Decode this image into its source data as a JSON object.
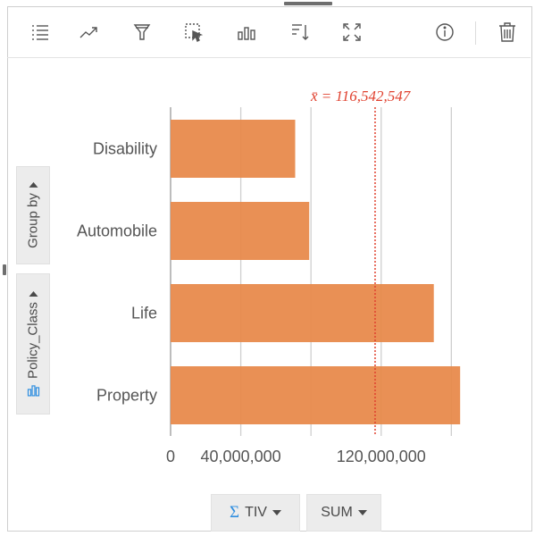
{
  "toolbar": {
    "icons": [
      "legend-icon",
      "trend-line-icon",
      "filter-icon",
      "select-icon",
      "visualization-type-icon",
      "sort-icon",
      "maximize-icon",
      "info-icon",
      "delete-icon"
    ]
  },
  "side_controls": {
    "group_by_label": "Group by",
    "field_label": "Policy_Class"
  },
  "bottom_controls": {
    "sigma_symbol": "Σ",
    "value_field_label": "TIV",
    "statistic_label": "SUM"
  },
  "chart_data": {
    "type": "bar",
    "orientation": "horizontal",
    "categories": [
      "Disability",
      "Automobile",
      "Life",
      "Property"
    ],
    "values": [
      71000000,
      79000000,
      150000000,
      165000000
    ],
    "xlim": [
      0,
      170000000
    ],
    "x_gridlines": [
      0,
      40000000,
      80000000,
      120000000,
      160000000
    ],
    "x_tick_labels": [
      {
        "value": 0,
        "label": "0"
      },
      {
        "value": 40000000,
        "label": "40,000,000"
      },
      {
        "value": 120000000,
        "label": "120,000,000"
      }
    ],
    "mean": {
      "value": 116542547,
      "label": "x̄ = 116,542,547"
    },
    "bar_color": "#e8894a",
    "mean_color": "#e0412f",
    "title": "",
    "xlabel": "",
    "ylabel": "",
    "grid": true,
    "legend": "none"
  }
}
